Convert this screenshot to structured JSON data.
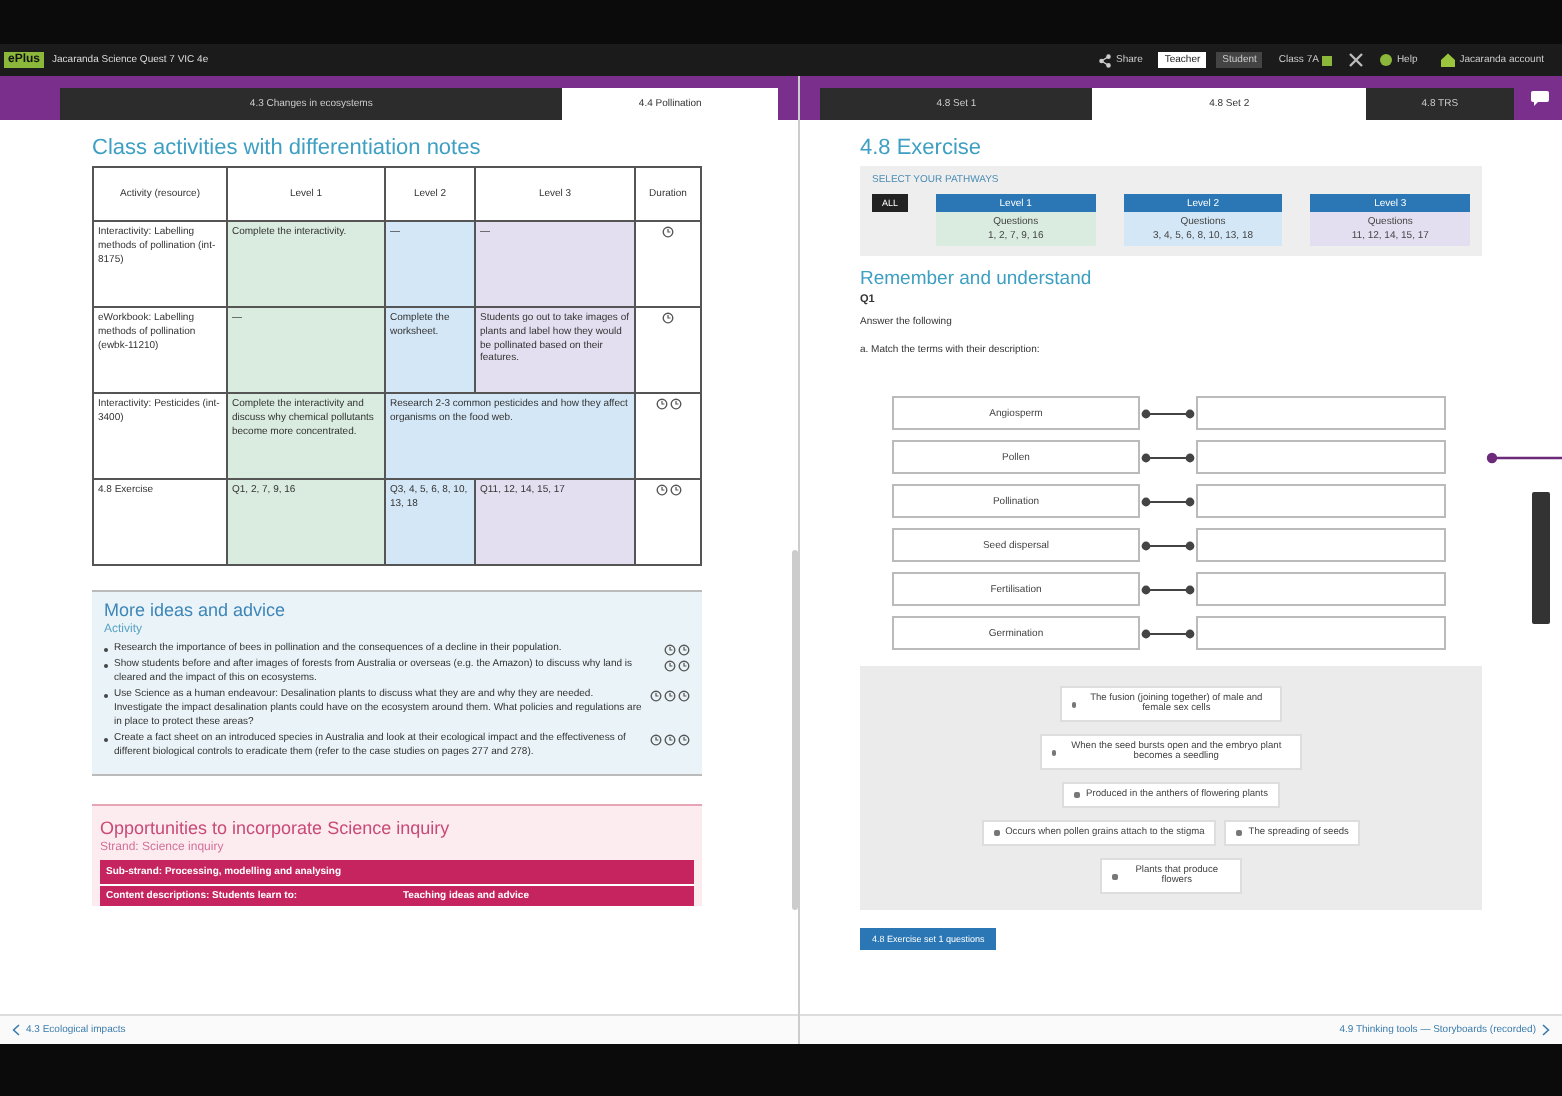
{
  "top_bar": {
    "logo": "ePlus",
    "title": "Jacaranda Science Quest 7 VIC 4e",
    "buttons": [
      {
        "kind": "share",
        "label": "Share"
      },
      {
        "kind": "toggle",
        "label": "Teacher",
        "selected": true
      },
      {
        "kind": "toggle",
        "label": "Student",
        "selected": false
      },
      {
        "kind": "class",
        "label": "Class 7A"
      },
      {
        "kind": "close"
      },
      {
        "kind": "help",
        "label": "Help"
      },
      {
        "kind": "home",
        "label": "Jacaranda account"
      }
    ]
  },
  "left_panel": {
    "tabs": [
      {
        "label": "4.3 Changes in ecosystems",
        "selected": false
      },
      {
        "label": "4.4 Pollination",
        "selected": true
      }
    ],
    "heading": "Class activities with differentiation notes",
    "table": {
      "columns": [
        "Activity (resource)",
        "Level 1",
        "Level 2",
        "Level 3",
        "Duration"
      ],
      "rows": [
        {
          "cells": [
            {
              "kind": "activity",
              "text": "Interactivity: Labelling methods of pollination (int-8175)"
            },
            {
              "kind": "level1",
              "text": "Complete the interactivity."
            },
            {
              "kind": "level2",
              "text": "—"
            },
            {
              "kind": "level3",
              "text": "—"
            },
            {
              "kind": "duration",
              "clocks": [
                {
                  "kind": "clock"
                }
              ]
            }
          ]
        },
        {
          "cells": [
            {
              "kind": "activity",
              "text": "eWorkbook: Labelling methods of pollination (ewbk-11210)"
            },
            {
              "kind": "level1",
              "text": "—"
            },
            {
              "kind": "level2",
              "text": "Complete the worksheet."
            },
            {
              "kind": "level3",
              "text": "Students go out to take images of plants and label how they would be pollinated based on their features."
            },
            {
              "kind": "duration",
              "clocks": [
                {
                  "kind": "clock"
                }
              ]
            }
          ]
        },
        {
          "cells": [
            {
              "kind": "activity",
              "text": "Interactivity: Pesticides (int-3400)"
            },
            {
              "kind": "level1",
              "text": "Complete the interactivity and discuss why chemical pollutants become more concentrated."
            },
            {
              "kind": "level23",
              "colspan": 2,
              "text": "Research 2-3 common pesticides and how they affect organisms on the food web."
            },
            {
              "kind": "duration",
              "clocks": [
                {
                  "kind": "clock"
                },
                {
                  "kind": "clock"
                }
              ]
            }
          ]
        },
        {
          "cells": [
            {
              "kind": "activity",
              "text": "4.8 Exercise"
            },
            {
              "kind": "level1",
              "text": "Q1, 2, 7, 9, 16"
            },
            {
              "kind": "level2",
              "text": "Q3, 4, 5, 6, 8, 10, 13, 18"
            },
            {
              "kind": "level3",
              "text": "Q11, 12, 14, 15, 17"
            },
            {
              "kind": "duration",
              "clocks": [
                {
                  "kind": "clock"
                },
                {
                  "kind": "clock"
                }
              ]
            }
          ]
        }
      ]
    },
    "ideas": {
      "heading": "More ideas and advice",
      "subheading": "Activity",
      "items": [
        {
          "text": "Research the importance of bees in pollination and the consequences of a decline in their population.",
          "clocks": [
            {
              "kind": "clock"
            },
            {
              "kind": "clock"
            }
          ]
        },
        {
          "text": "Show students before and after images of forests from Australia or overseas (e.g. the Amazon) to discuss why land is cleared and the impact of this on ecosystems.",
          "clocks": [
            {
              "kind": "clock"
            },
            {
              "kind": "clock"
            }
          ]
        },
        {
          "text": "Use Science as a human endeavour: Desalination plants to discuss what they are and why they are needed. Investigate the impact desalination plants could have on the ecosystem around them. What policies and regulations are in place to protect these areas?",
          "clocks": [
            {
              "kind": "clock"
            },
            {
              "kind": "clock"
            },
            {
              "kind": "clock"
            }
          ]
        },
        {
          "text": "Create a fact sheet on an introduced species in Australia and look at their ecological impact and the effectiveness of different biological controls to eradicate them (refer to the case studies on pages 277 and 278).",
          "clocks": [
            {
              "kind": "clock"
            },
            {
              "kind": "clock"
            },
            {
              "kind": "clock"
            }
          ]
        }
      ]
    },
    "inquiry": {
      "heading": "Opportunities to incorporate Science inquiry",
      "strand": "Strand: Science inquiry",
      "sub_strand": "Sub-strand: Processing, modelling and analysing",
      "columns": [
        "Content descriptions: Students learn to:",
        "Teaching ideas and advice"
      ]
    },
    "footer_link": "4.3 Ecological impacts"
  },
  "right_panel": {
    "tabs": [
      {
        "label": "4.8 Set 1",
        "selected": false
      },
      {
        "label": "4.8 Set 2",
        "selected": true
      },
      {
        "label": "4.8 TRS",
        "selected": false
      }
    ],
    "heading": "4.8 Exercise",
    "pathways": {
      "title": "SELECT YOUR PATHWAYS",
      "all_button": "ALL",
      "levels": [
        {
          "label": "Level 1",
          "caption": "Questions",
          "questions": "1, 2, 7, 9, 16",
          "kind": "level1"
        },
        {
          "label": "Level 2",
          "caption": "Questions",
          "questions": "3, 4, 5, 6, 8, 10, 13, 18",
          "kind": "level2"
        },
        {
          "label": "Level 3",
          "caption": "Questions",
          "questions": "11, 12, 14, 15, 17",
          "kind": "level3"
        }
      ]
    },
    "section": "Remember and understand",
    "question": "Q1",
    "instruction": "Answer the following",
    "part": "a. Match the terms with their description:",
    "terms": [
      "Angiosperm",
      "Pollen",
      "Pollination",
      "Seed dispersal",
      "Fertilisation",
      "Germination"
    ],
    "options": [
      "The fusion (joining together) of male and female sex cells",
      "When the seed bursts open and the embryo plant becomes a seedling",
      "Produced in the anthers of flowering plants",
      "Occurs when pollen grains attach to the stigma",
      "The spreading of seeds",
      "Plants that produce flowers"
    ],
    "submit_button": "4.8 Exercise set 1 questions",
    "footer_link": "4.9 Thinking tools — Storyboards (recorded)"
  }
}
